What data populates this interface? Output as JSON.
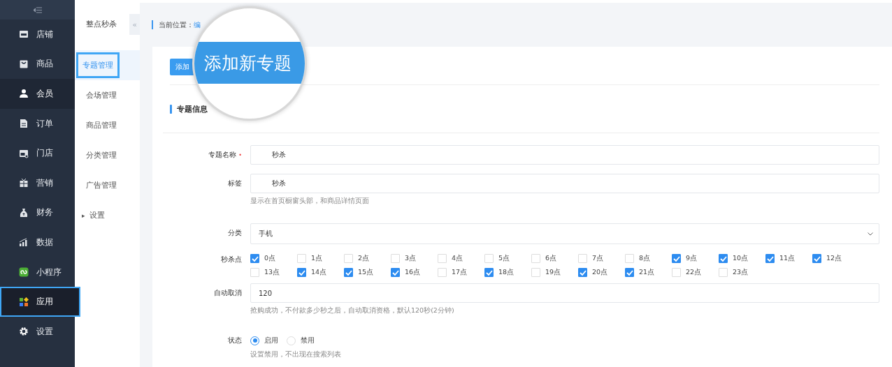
{
  "sidebar": {
    "items": [
      {
        "label": "店铺",
        "selected": false,
        "highlighted": false
      },
      {
        "label": "商品",
        "selected": false,
        "highlighted": false
      },
      {
        "label": "会员",
        "selected": false,
        "hovered": true,
        "highlighted": false
      },
      {
        "label": "订单",
        "selected": false,
        "highlighted": false
      },
      {
        "label": "门店",
        "selected": false,
        "highlighted": false
      },
      {
        "label": "营销",
        "selected": false,
        "highlighted": false
      },
      {
        "label": "财务",
        "selected": false,
        "highlighted": false
      },
      {
        "label": "数据",
        "selected": false,
        "highlighted": false
      },
      {
        "label": "小程序",
        "selected": false,
        "highlighted": false
      },
      {
        "label": "应用",
        "selected": true,
        "highlighted": true
      },
      {
        "label": "设置",
        "selected": false,
        "highlighted": false
      }
    ]
  },
  "subnav": {
    "title": "整点秒杀",
    "collapse": "«",
    "items": [
      {
        "label": "专题管理",
        "selected": true,
        "highlighted": true
      },
      {
        "label": "会场管理",
        "selected": false,
        "highlighted": false
      },
      {
        "label": "商品管理",
        "selected": false,
        "highlighted": false
      },
      {
        "label": "分类管理",
        "selected": false,
        "highlighted": false
      },
      {
        "label": "广告管理",
        "selected": false,
        "highlighted": false
      },
      {
        "label": "设置",
        "selected": false,
        "highlighted": false,
        "expander": "▸"
      }
    ]
  },
  "breadcrumb": {
    "label": "当前位置：",
    "link": "编"
  },
  "add_button": "添加",
  "magnifier": {
    "text": "添加新专题"
  },
  "section_title": "专题信息",
  "form": {
    "rows": [
      {
        "kind": "input",
        "label": "专题名称",
        "required_mark": "•",
        "value": "秒杀"
      },
      {
        "kind": "input",
        "label": "标签",
        "value": "秒杀",
        "hint": "显示在首页橱窗头部，和商品详情页面"
      },
      {
        "kind": "select",
        "label": "分类",
        "value": "手机"
      },
      {
        "kind": "checkboxes",
        "label": "秒杀点",
        "options": [
          {
            "label": "0点",
            "checked": true
          },
          {
            "label": "1点",
            "checked": false
          },
          {
            "label": "2点",
            "checked": false
          },
          {
            "label": "3点",
            "checked": false
          },
          {
            "label": "4点",
            "checked": false
          },
          {
            "label": "5点",
            "checked": false
          },
          {
            "label": "6点",
            "checked": false
          },
          {
            "label": "7点",
            "checked": false
          },
          {
            "label": "8点",
            "checked": false
          },
          {
            "label": "9点",
            "checked": true
          },
          {
            "label": "10点",
            "checked": true
          },
          {
            "label": "11点",
            "checked": true
          },
          {
            "label": "12点",
            "checked": true
          },
          {
            "label": "13点",
            "checked": false
          },
          {
            "label": "14点",
            "checked": true
          },
          {
            "label": "15点",
            "checked": true
          },
          {
            "label": "16点",
            "checked": true
          },
          {
            "label": "17点",
            "checked": false
          },
          {
            "label": "18点",
            "checked": true
          },
          {
            "label": "19点",
            "checked": false
          },
          {
            "label": "20点",
            "checked": true
          },
          {
            "label": "21点",
            "checked": true
          },
          {
            "label": "22点",
            "checked": false
          },
          {
            "label": "23点",
            "checked": false
          }
        ]
      },
      {
        "kind": "number",
        "label": "自动取消",
        "value": "120",
        "hint": "抢购成功，不付款多少秒之后，自动取消资格，默认120秒(2分钟)"
      },
      {
        "kind": "radios",
        "label": "状态",
        "options": [
          {
            "label": "启用",
            "selected": true
          },
          {
            "label": "禁用",
            "selected": false
          }
        ],
        "hint": "设置禁用，不出现在搜索列表"
      }
    ]
  }
}
